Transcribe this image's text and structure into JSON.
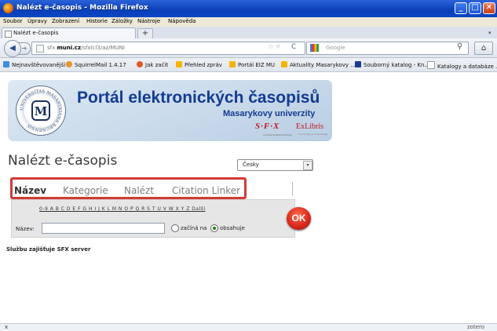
{
  "window": {
    "title": "Nalézt e-časopis - Mozilla Firefox"
  },
  "menu": [
    "Soubor",
    "Úpravy",
    "Zobrazení",
    "Historie",
    "Záložky",
    "Nástroje",
    "Nápověda"
  ],
  "tab": {
    "label": "Nalézt e-časopis",
    "new_tab": "+"
  },
  "nav": {
    "url_domain": "sfx.",
    "url_host": "muni.cz",
    "url_path": "/sfxlcl3/az/MUNI",
    "search_placeholder": "Google"
  },
  "bookmarks": [
    {
      "label": "Nejnavštěvovanější",
      "color": "#3a8de0"
    },
    {
      "label": "SquirrelMail 1.4.17",
      "color": "#e8932e"
    },
    {
      "label": "Jak začít",
      "color": "#e05a22"
    },
    {
      "label": "Přehled zpráv",
      "color": "#f5b400"
    },
    {
      "label": "Portál EIZ MU",
      "color": "#f5b400"
    },
    {
      "label": "Aktuality Masarykovy ...",
      "color": "#f5b400"
    },
    {
      "label": "Souborný katalog - Kn...",
      "color": "#1b3d8f"
    },
    {
      "label": "Katalogy a databáze ...",
      "color": "#ffffff"
    }
  ],
  "header": {
    "portal_title": "Portál elektronických časopisů",
    "university": "Masarykovy univerzity",
    "sfx_logo": "S·F·X",
    "sfx_tagline": "context-sensitive linking",
    "exlibris": "ExLibris",
    "exlibris_tagline": "The bridge to knowledge",
    "seal_text": "UNIVERSITAS MASARYKIANA BRUNENSIS"
  },
  "page": {
    "title": "Nalézt e-časopis",
    "language": "Česky",
    "tabs": [
      "Název",
      "Kategorie",
      "Nalézt",
      "Citation Linker"
    ],
    "alphabet": "0-9 A B C D E F G H I J K L M N O P Q R S T U V W X Y Z Další",
    "name_label": "Název:",
    "name_value": "",
    "radio_starts": "začíná na",
    "radio_contains": "obsahuje",
    "ok_label": "OK",
    "footer": "Službu zajišťuje SFX server"
  },
  "status": {
    "close": "x",
    "zotero": "zotero"
  },
  "colors": {
    "titlebar": "#0a3fb8",
    "header_text": "#123c91",
    "highlight_border": "#d23a36",
    "ok_button": "#d8261a",
    "sfx_red": "#c0181b"
  }
}
